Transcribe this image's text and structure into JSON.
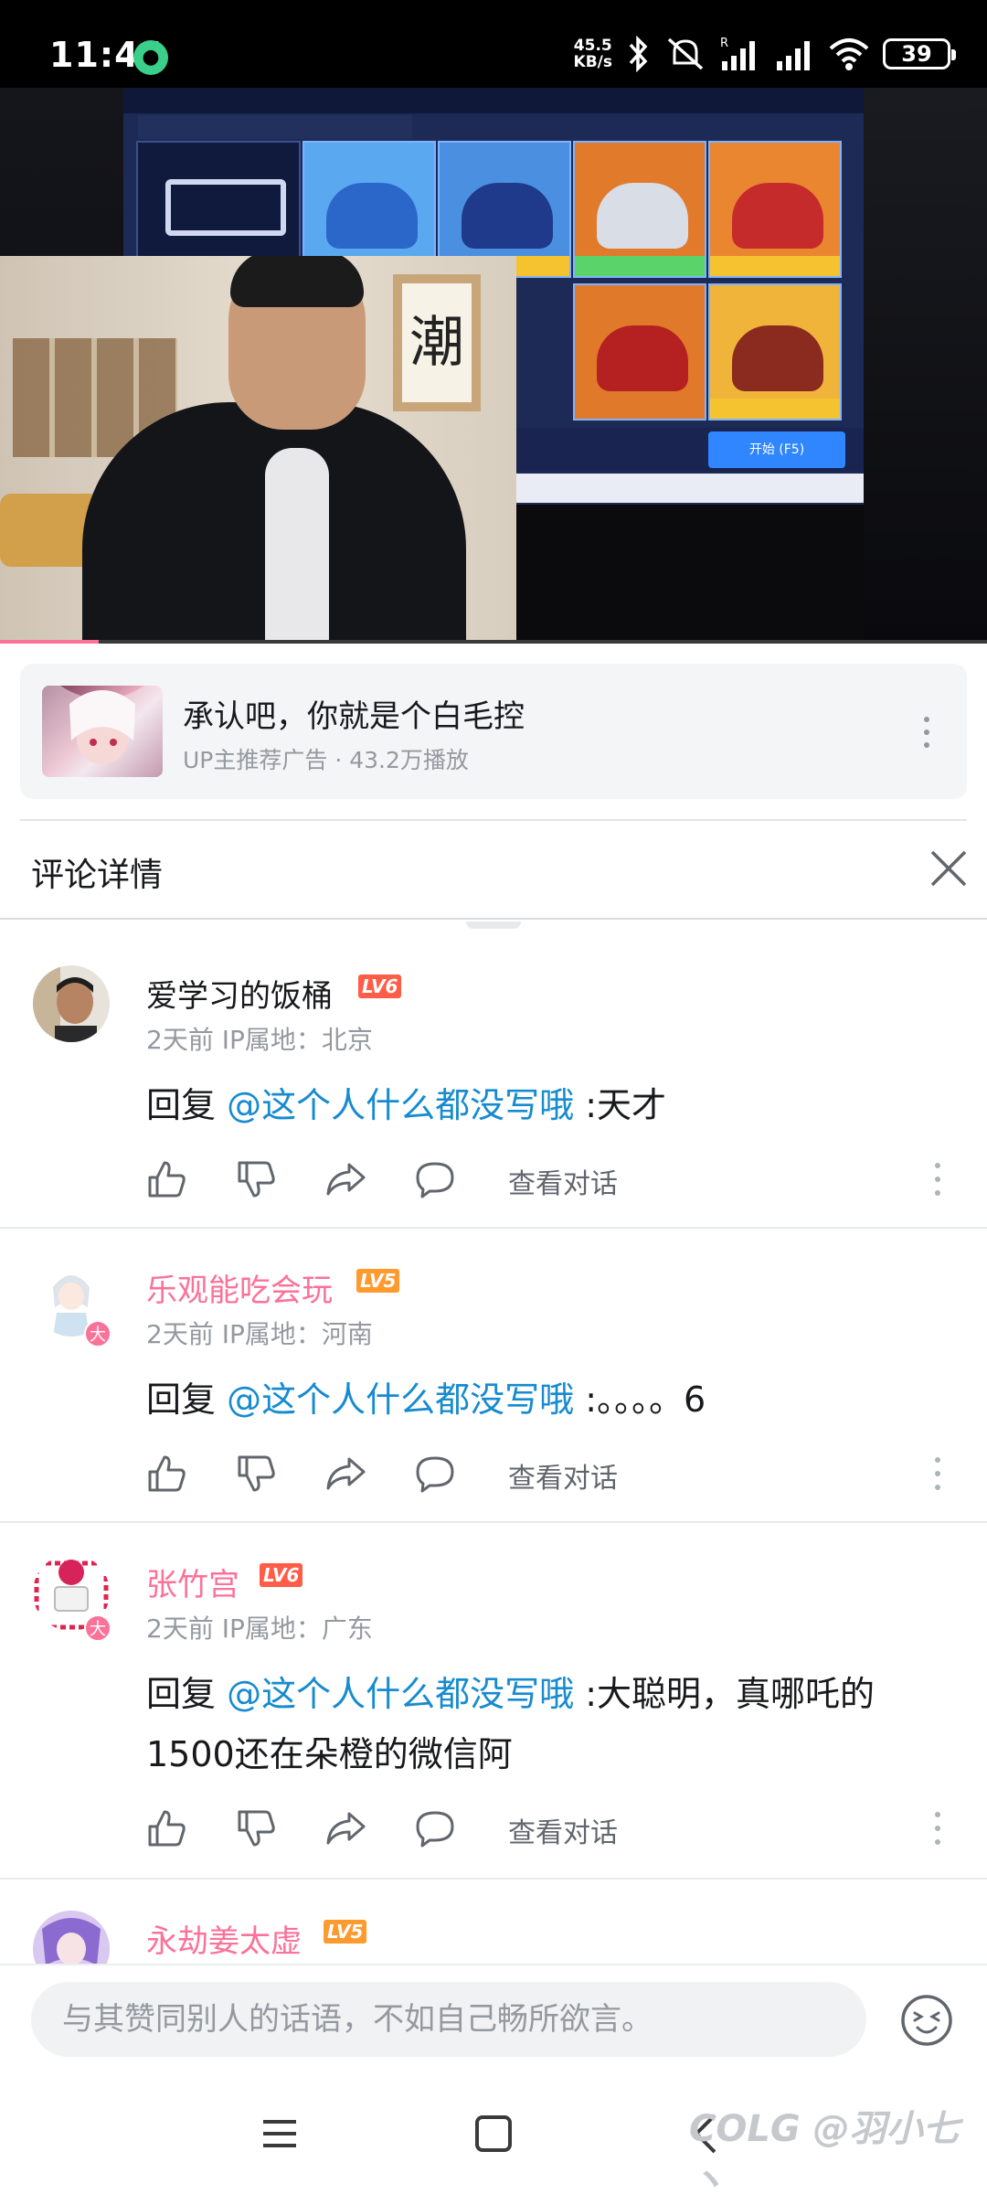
{
  "status_bar": {
    "time": "11:44",
    "net_speed_value": "45.5",
    "net_speed_unit": "KB/s",
    "signal_label": "R",
    "battery": "39"
  },
  "video": {
    "progress": 0.1,
    "wall_character": "潮",
    "game_start_label": "开始 (F5)"
  },
  "ad": {
    "title": "承认吧，你就是个白毛控",
    "meta": "UP主推荐广告 · 43.2万播放"
  },
  "panel": {
    "title": "评论详情"
  },
  "comments": [
    {
      "name": "爱学习的饭桶",
      "level": "LV6",
      "vip": false,
      "meta": "2天前 IP属地：北京",
      "reply_prefix": "回复 ",
      "mention": "@这个人什么都没写哦",
      "text": " :天才",
      "view_dialog": "查看对话"
    },
    {
      "name": "乐观能吃会玩",
      "level": "LV5",
      "vip": true,
      "badge": "大",
      "meta": "2天前 IP属地：河南",
      "reply_prefix": "回复 ",
      "mention": "@这个人什么都没写哦",
      "text": " :。。。。6",
      "view_dialog": "查看对话"
    },
    {
      "name": "张竹宫",
      "level": "LV6",
      "vip": true,
      "badge": "大",
      "meta": "2天前 IP属地：广东",
      "reply_prefix": "回复 ",
      "mention": "@这个人什么都没写哦",
      "text": " :大聪明，真哪吒的1500还在朵橙的微信阿",
      "view_dialog": "查看对话"
    },
    {
      "name": "永劫姜太虚",
      "level": "LV5",
      "vip": true
    }
  ],
  "input": {
    "placeholder": "与其赞同别人的话语，不如自己畅所欲言。"
  },
  "watermark": "COLG @羽小七丶",
  "colors": {
    "accent_pink": "#fb7299",
    "mention_blue": "#178bcf",
    "lv6": "#ff5d47",
    "lv5": "#ff9a2e"
  },
  "icons": [
    "like-icon",
    "dislike-icon",
    "share-icon",
    "reply-icon",
    "more-icon",
    "close-icon",
    "emoji-icon",
    "menu-icon",
    "home-icon",
    "back-icon"
  ]
}
